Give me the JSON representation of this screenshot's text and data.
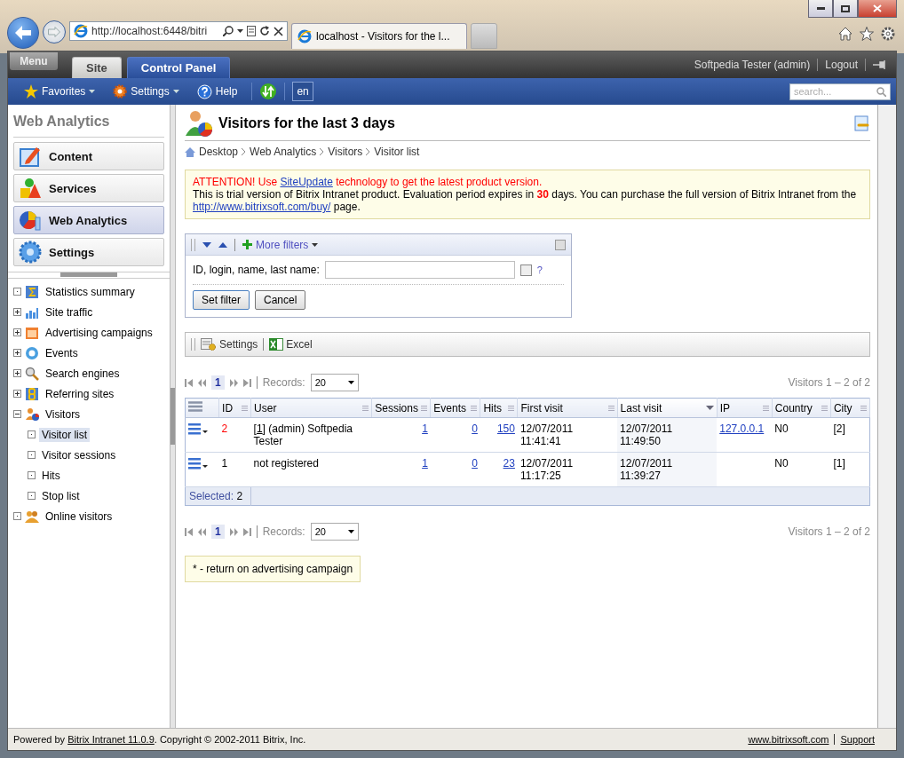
{
  "browser": {
    "address": "http://localhost:6448/bitri",
    "tab_title": "localhost - Visitors for the l..."
  },
  "admin_bar": {
    "menu": "Menu",
    "tabs": [
      {
        "label": "Site",
        "selected": false
      },
      {
        "label": "Control Panel",
        "selected": true
      }
    ],
    "user": "Softpedia Tester (admin)",
    "logout": "Logout"
  },
  "toolbar": {
    "items": [
      {
        "label": "Favorites",
        "kind": "favorites"
      },
      {
        "label": "Settings",
        "kind": "settings"
      },
      {
        "label": "Help",
        "kind": "help"
      }
    ],
    "language": "en",
    "search": {
      "placeholder": "search..."
    }
  },
  "sidebar": {
    "title": "Web Analytics",
    "sections": [
      {
        "label": "Content",
        "selected": false
      },
      {
        "label": "Services",
        "selected": false
      },
      {
        "label": "Web Analytics",
        "selected": true
      },
      {
        "label": "Settings",
        "selected": false
      }
    ],
    "tree": [
      {
        "label": "Statistics summary",
        "kind": "leaf",
        "selected": false
      },
      {
        "label": "Site traffic",
        "kind": "folder",
        "expanded": false,
        "selected": false
      },
      {
        "label": "Advertising campaigns",
        "kind": "folder",
        "expanded": false,
        "selected": false
      },
      {
        "label": "Events",
        "kind": "folder",
        "expanded": false,
        "selected": false
      },
      {
        "label": "Search engines",
        "kind": "folder",
        "expanded": false,
        "selected": false
      },
      {
        "label": "Referring sites",
        "kind": "folder",
        "expanded": false,
        "selected": false
      },
      {
        "label": "Visitors",
        "kind": "folder",
        "expanded": true,
        "selected": false,
        "children": [
          {
            "label": "Visitor list",
            "kind": "leaf",
            "selected": true
          },
          {
            "label": "Visitor sessions",
            "kind": "leaf",
            "selected": false
          },
          {
            "label": "Hits",
            "kind": "leaf",
            "selected": false
          },
          {
            "label": "Stop list",
            "kind": "leaf",
            "selected": false
          }
        ]
      },
      {
        "label": "Online visitors",
        "kind": "leaf",
        "selected": false
      }
    ]
  },
  "page": {
    "title": "Visitors for the last 3 days",
    "breadcrumbs": [
      "Desktop",
      "Web Analytics",
      "Visitors",
      "Visitor list"
    ]
  },
  "notice": {
    "attention": {
      "before": "ATTENTION! Use ",
      "link": "SiteUpdate",
      "after": " technology to get the latest product version."
    },
    "trial": {
      "before": "This is trial version of Bitrix Intranet product. Evaluation period expires in ",
      "days": "30",
      "middle": " days. You can purchase the full version of Bitrix Intranet from the ",
      "link": "http://www.bitrixsoft.com/buy/",
      "after": " page."
    }
  },
  "filter": {
    "more_filters": "More filters",
    "field_label": "ID, login, name, last name:",
    "checked": false,
    "help": "?",
    "buttons": [
      "Set filter",
      "Cancel"
    ]
  },
  "list_toolbar": [
    {
      "label": "Settings",
      "kind": "settings"
    },
    {
      "label": "Excel",
      "kind": "excel"
    }
  ],
  "pagers": [
    {
      "page": "1",
      "records_label": "Records:",
      "records": "20",
      "summary": "Visitors 1 – 2 of 2"
    },
    {
      "page": "1",
      "records_label": "Records:",
      "records": "20",
      "summary": "Visitors 1 – 2 of 2"
    }
  ],
  "table": {
    "columns": [
      {
        "label": "ID",
        "sorted": false
      },
      {
        "label": "User",
        "sorted": false
      },
      {
        "label": "Sessions",
        "sorted": false
      },
      {
        "label": "Events",
        "sorted": false
      },
      {
        "label": "Hits",
        "sorted": false
      },
      {
        "label": "First visit",
        "sorted": false
      },
      {
        "label": "Last visit",
        "sorted": true
      },
      {
        "label": "IP",
        "sorted": false
      },
      {
        "label": "Country",
        "sorted": false
      },
      {
        "label": "City",
        "sorted": false
      }
    ],
    "rows": [
      {
        "id": "2",
        "color": "#ff0000",
        "user": {
          "prefix": "[",
          "link": "1",
          "suffix": "] (admin) Softpedia Tester"
        },
        "sessions": "1",
        "events": "0",
        "hits": "150",
        "first_visit": "12/07/2011 11:41:41",
        "last_visit": "12/07/2011 11:49:50",
        "ip": "127.0.0.1",
        "country": "N0",
        "city": "[2]"
      },
      {
        "id": "1",
        "color": "#000000",
        "user": {
          "suffix": "not registered"
        },
        "sessions": "1",
        "events": "0",
        "hits": "23",
        "first_visit": "12/07/2011 11:17:25",
        "last_visit": "12/07/2011 11:39:27",
        "country": "N0",
        "city": "[1]"
      }
    ],
    "selected_label": "Selected:",
    "selected_count": "2"
  },
  "note": "* - return on advertising campaign",
  "footer": {
    "before": "Powered by ",
    "link": "Bitrix Intranet 11.0.9",
    "after": ". Copyright © 2002-2011 Bitrix, Inc.",
    "links": [
      "www.bitrixsoft.com",
      "Support"
    ]
  }
}
